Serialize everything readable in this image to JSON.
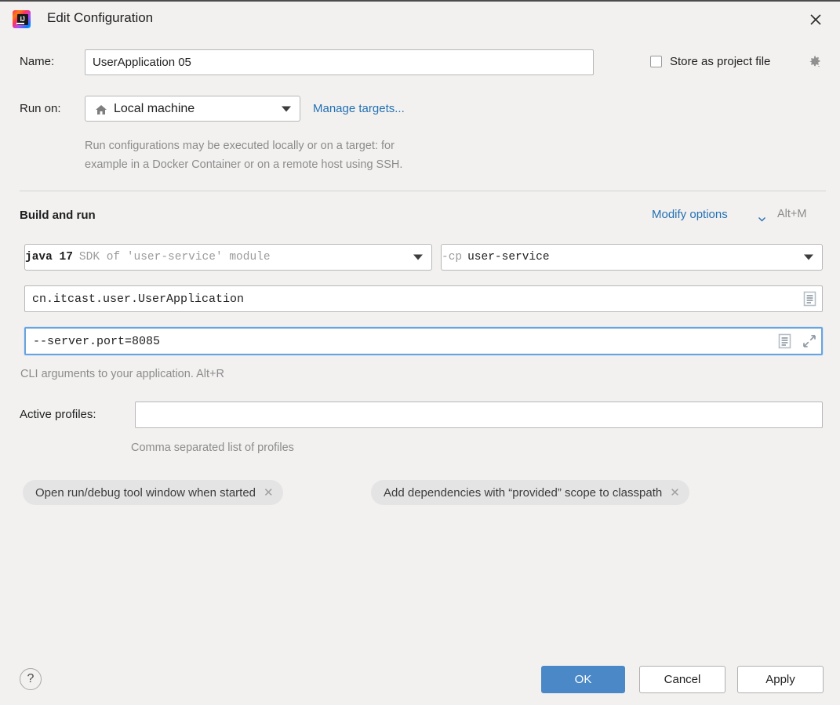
{
  "window": {
    "title": "Edit Configuration",
    "app_icon": "intellij-idea-logo",
    "close_icon": "close-icon"
  },
  "name_row": {
    "label": "Name:",
    "value": "UserApplication 05",
    "placeholder": ""
  },
  "store_as_project_file": {
    "label": "Store as project file",
    "checked": false,
    "gear_icon": "gear-icon"
  },
  "run_on": {
    "label": "Run on:",
    "selected": "Local machine",
    "target_icon": "home-icon",
    "manage_link": "Manage targets...",
    "description_line1": "Run configurations may be executed locally or on a target: for",
    "description_line2": "example in a Docker Container or on a remote host using SSH."
  },
  "build_and_run": {
    "section_title": "Build and run",
    "modify_options_link": "Modify options",
    "modify_options_shortcut": "Alt+M",
    "jre_combo": {
      "value": "java 17",
      "secondary": "SDK of 'user-service' module"
    },
    "classpath_combo": {
      "flag": "-cp",
      "value": "user-service"
    },
    "main_class": {
      "value": "cn.itcast.user.UserApplication",
      "expand_icon": "document-list-icon"
    },
    "program_arguments": {
      "value": "--server.port=8085",
      "focused": true,
      "document_icon": "document-list-icon",
      "expand_icon": "expand-arrows-icon",
      "hint": "CLI arguments to your application. Alt+R"
    }
  },
  "active_profiles": {
    "label": "Active profiles:",
    "value": "",
    "placeholder": "",
    "hint": "Comma separated list of profiles"
  },
  "option_chips": [
    {
      "label": "Open run/debug tool window when started",
      "remove_icon": "close-icon"
    },
    {
      "label": "Add dependencies with “provided” scope to classpath",
      "remove_icon": "close-icon"
    }
  ],
  "footer": {
    "help_label": "?",
    "ok_label": "OK",
    "cancel_label": "Cancel",
    "apply_label": "Apply"
  },
  "colors": {
    "dialog_background": "#f2f1f0",
    "accent_blue": "#4a88c7",
    "link_blue": "#2470b3",
    "field_border": "#b8b8b8",
    "focus_border": "#6aa3dd",
    "hint_gray": "#8c8c8c",
    "chip_background": "#e4e4e4"
  }
}
